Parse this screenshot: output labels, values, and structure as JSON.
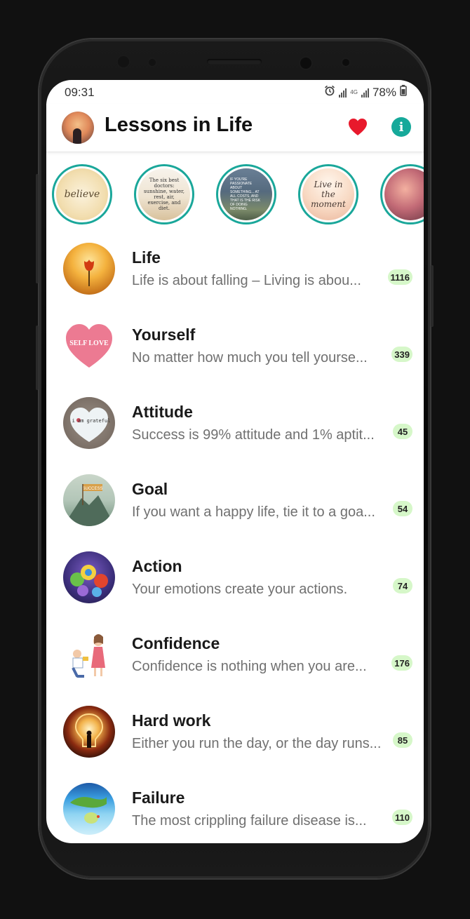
{
  "status_bar": {
    "time": "09:31",
    "network": "4G",
    "battery": "78%"
  },
  "app_bar": {
    "title": "Lessons in Life"
  },
  "stories": [
    {
      "label": "believe"
    },
    {
      "label": "The six best doctors: sunshine, water, rest, air, exercise, and diet."
    },
    {
      "label": "IF YOU'RE PASSIONATE ABOUT SOMETHING... AT ALL COSTS, AND THAT IS THE RISK OF DOING NOTHING."
    },
    {
      "label": "Live in the moment"
    },
    {
      "label": ""
    }
  ],
  "categories": [
    {
      "title": "Life",
      "subtitle": "Life is about falling – Living is abou...",
      "count": "1116"
    },
    {
      "title": "Yourself",
      "subtitle": "No matter how much you tell yourse...",
      "count": "339",
      "thumb_label": "SELF LOVE"
    },
    {
      "title": "Attitude",
      "subtitle": "Success is 99% attitude and 1% aptit...",
      "count": "45",
      "thumb_label": "i am grateful"
    },
    {
      "title": "Goal",
      "subtitle": "If you want a happy life, tie it to a goa...",
      "count": "54",
      "thumb_label": "SUCCESS"
    },
    {
      "title": "Action",
      "subtitle": "Your emotions create your actions.",
      "count": "74"
    },
    {
      "title": "Confidence",
      "subtitle": "Confidence is nothing when you are...",
      "count": "176"
    },
    {
      "title": "Hard work",
      "subtitle": "Either you run the day, or the day runs...",
      "count": "85"
    },
    {
      "title": "Failure",
      "subtitle": "The most crippling failure disease is...",
      "count": "110"
    }
  ],
  "colors": {
    "accent": "#1aa79a",
    "heart": "#e8192c",
    "badge_bg": "#d6f7c9"
  }
}
